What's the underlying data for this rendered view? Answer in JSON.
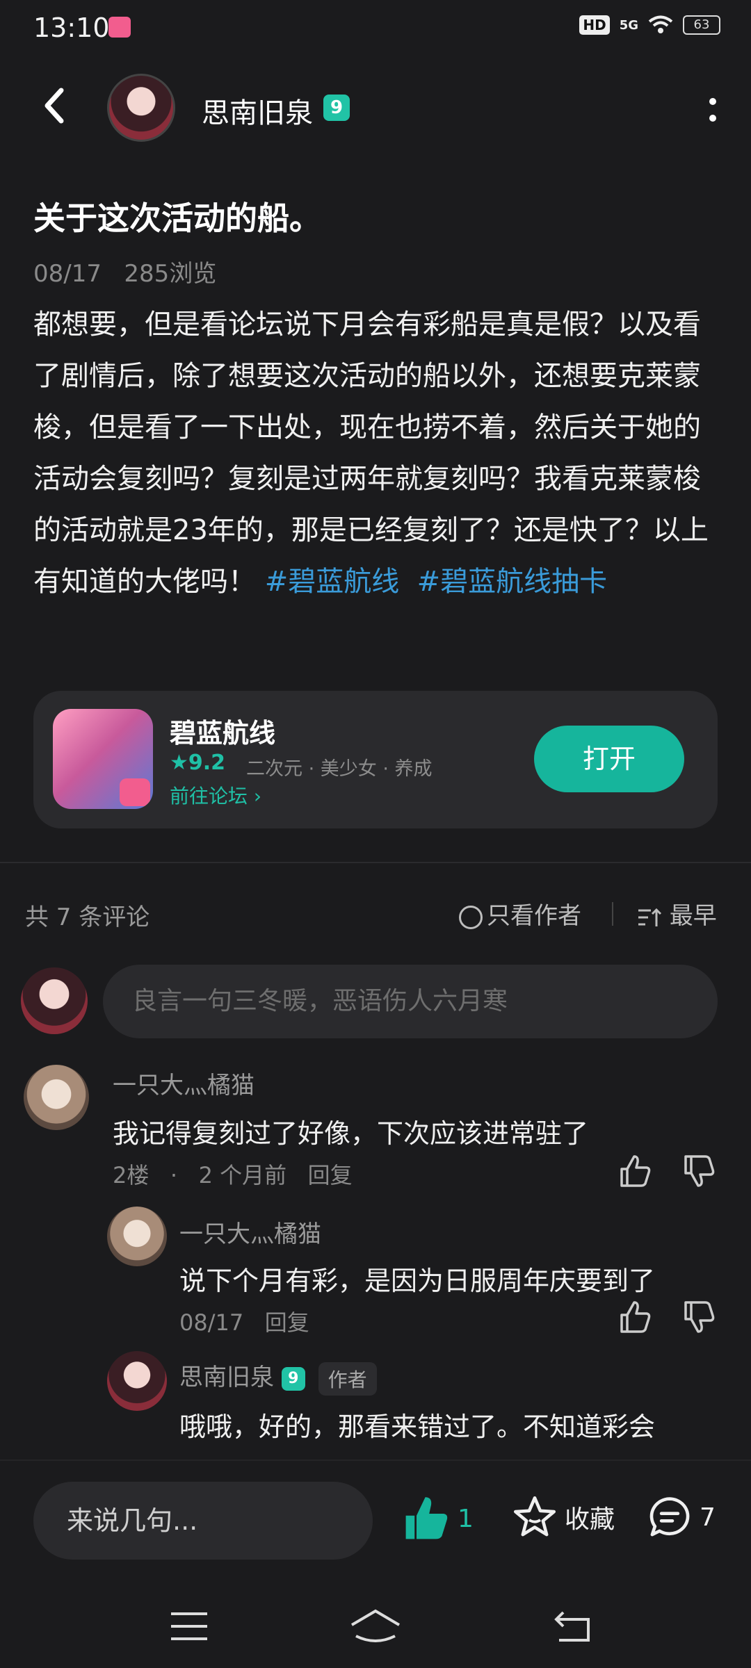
{
  "status_bar": {
    "time": "13:10",
    "hd": "HD",
    "network": "5G",
    "battery": "63"
  },
  "header": {
    "username": "思南旧泉",
    "level": "9"
  },
  "post": {
    "title": "关于这次活动的船。",
    "date": "08/17",
    "views": "285浏览",
    "body": "都想要，但是看论坛说下月会有彩船是真是假？以及看了剧情后，除了想要这次活动的船以外，还想要克莱蒙梭，但是看了一下出处，现在也捞不着，然后关于她的活动会复刻吗？复刻是过两年就复刻吗？我看克莱蒙梭的活动就是23年的，那是已经复刻了？还是快了？以上有知道的大佬吗！",
    "tags": [
      "#碧蓝航线",
      "#碧蓝航线抽卡"
    ]
  },
  "game_card": {
    "name": "碧蓝航线",
    "rating": "★9.2",
    "tags": "二次元 · 美少女 · 养成",
    "forum_link": "前往论坛 ›",
    "open_button": "打开"
  },
  "comments_header": {
    "count_label": "共 7 条评论",
    "author_only": "只看作者",
    "sort": "最早"
  },
  "comment_input": {
    "placeholder": "良言一句三冬暖，恶语伤人六月寒"
  },
  "comments": [
    {
      "user": "一只大灬橘猫",
      "text": "我记得复刻过了好像，下次应该进常驻了",
      "floor": "2楼",
      "dot": "·",
      "time": "2 个月前",
      "reply": "回复"
    }
  ],
  "replies": [
    {
      "user": "一只大灬橘猫",
      "text": "说下个月有彩，是因为日服周年庆要到了",
      "time": "08/17",
      "reply": "回复"
    },
    {
      "user": "思南旧泉",
      "level": "9",
      "badge": "作者",
      "text": "哦哦，好的，那看来错过了。不知道彩会"
    }
  ],
  "bottom_bar": {
    "reply_placeholder": "来说几句...",
    "likes": "1",
    "favorite": "收藏",
    "comments": "7"
  },
  "colors": {
    "accent": "#16b59c",
    "tag": "#3a9bd9",
    "background": "#1b1b1d"
  }
}
